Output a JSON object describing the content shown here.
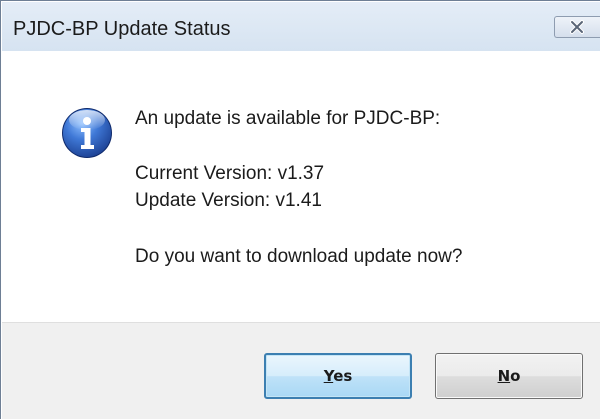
{
  "dialog": {
    "title": "PJDC-BP Update Status",
    "close_icon": "close-icon",
    "info_icon": "info-icon",
    "message": {
      "headline": "An update is available for PJDC-BP:",
      "current_version": "Current Version: v1.37",
      "update_version": "Update Version: v1.41",
      "question": "Do you want to download update now?"
    },
    "buttons": {
      "yes": {
        "before": "",
        "mnemonic": "Y",
        "after": "es"
      },
      "no": {
        "before": "",
        "mnemonic": "N",
        "after": "o"
      }
    }
  },
  "colors": {
    "title_bar": "#d6e3f1",
    "footer": "#f0f0f0",
    "default_button_border": "#3c7fb1",
    "info_icon": "#2f62b5"
  }
}
